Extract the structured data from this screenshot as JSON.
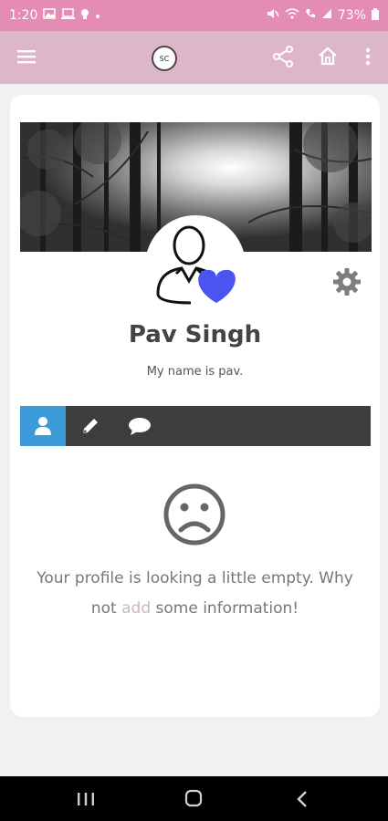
{
  "status_bar": {
    "time": "1:20",
    "battery": "73%"
  },
  "app_bar": {
    "logo_text": "SC"
  },
  "profile": {
    "name": "Pav Singh",
    "bio": "My name is pav."
  },
  "empty_state": {
    "line1": "Your profile is looking a little empty. Why",
    "prefix": "not ",
    "link": "add",
    "suffix": " some information!"
  },
  "colors": {
    "status_bar": "#e58cb4",
    "app_bar": "#ddb6c7",
    "tab_active": "#3a9bd8",
    "tab_bar": "#3d3d3d",
    "heart": "#4a54f0"
  }
}
